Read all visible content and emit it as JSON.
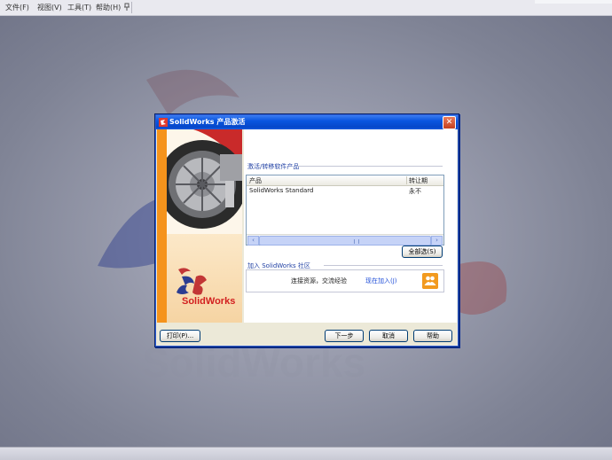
{
  "menubar": {
    "items": [
      "文件(F)",
      "视图(V)",
      "工具(T)",
      "帮助(H)"
    ]
  },
  "icons": {
    "pin": "pin-icon",
    "app": "solidworks-app-icon",
    "close": "close-icon",
    "notice": "users-icon"
  },
  "dialog": {
    "title": "SolidWorks 产品激活",
    "close_label": "✕",
    "group_products": "激活/转移软件产品",
    "list": {
      "col_product": "产品",
      "col_status": "转让期",
      "rows": [
        {
          "product": "SolidWorks Standard",
          "status": "永不"
        }
      ]
    },
    "select_all_label": "全部选(S)",
    "group_notice": "加入 SolidWorks 社区",
    "notice_text": "连接资源，交流经验",
    "notice_link": "现在加入(J)",
    "brand": "SolidWorks",
    "buttons": {
      "print": "打印(P)...",
      "next": "下一步",
      "cancel": "取消",
      "help": "帮助"
    }
  },
  "colors": {
    "titlebar": "#0a55df",
    "accent_orange": "#f5931c",
    "brand_red": "#d21f1f",
    "link_blue": "#1f4ed8"
  }
}
